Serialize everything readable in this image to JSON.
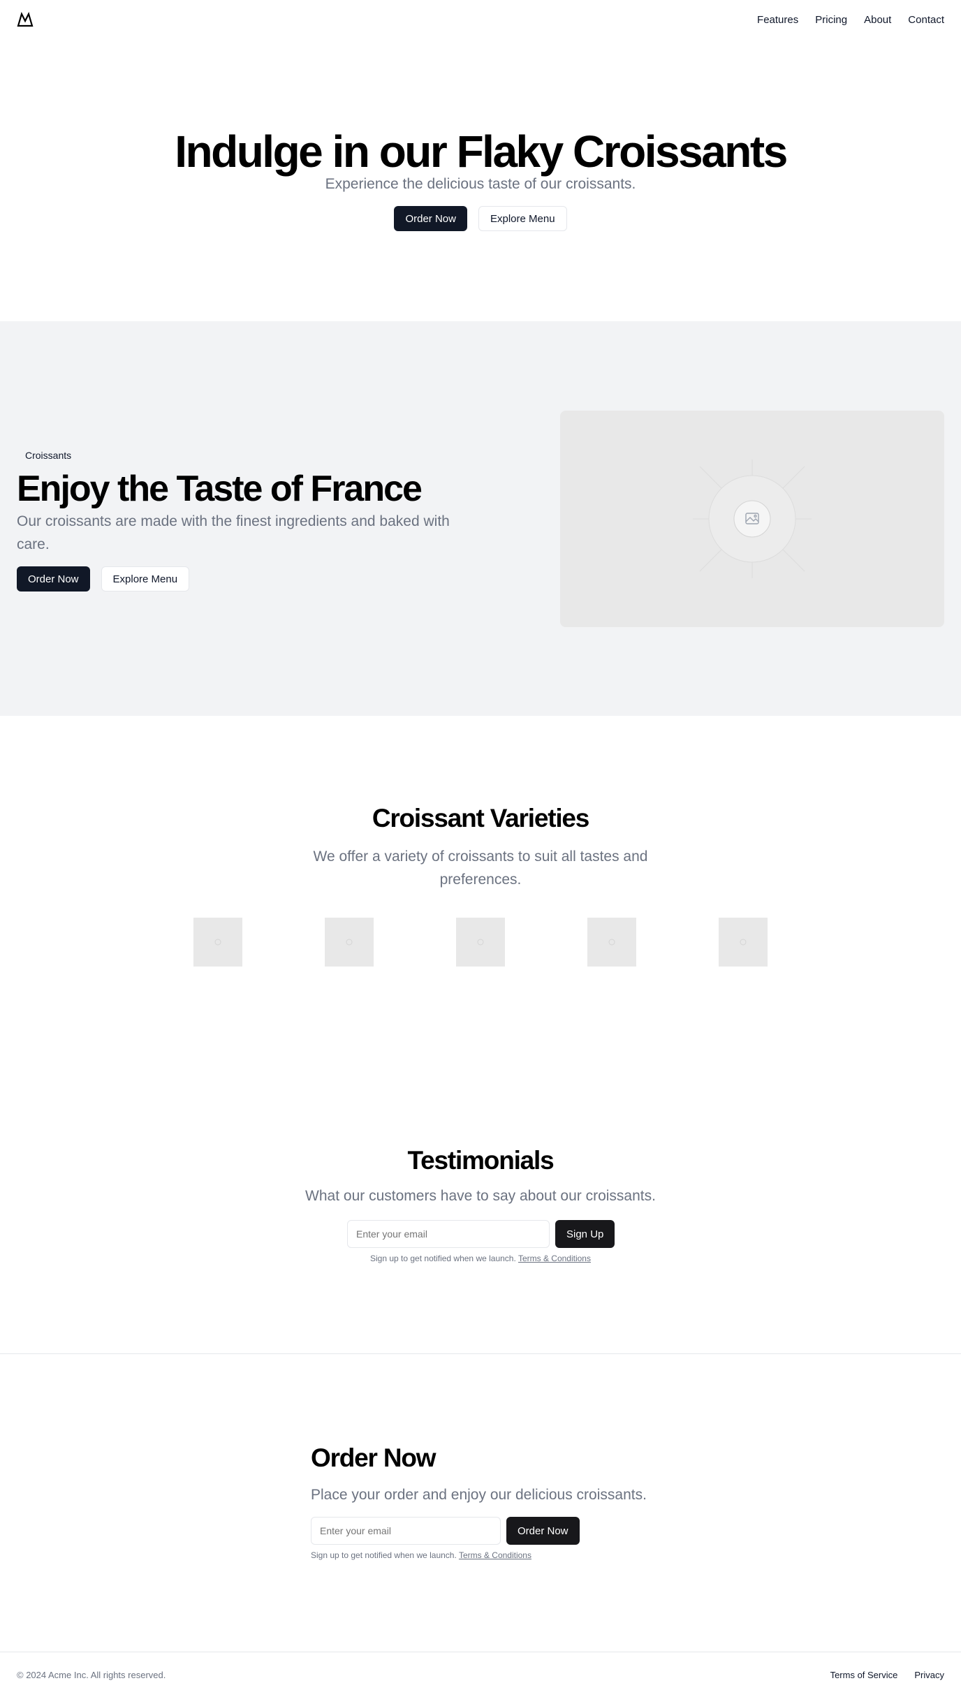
{
  "header": {
    "logo_icon": "mountain-icon",
    "nav": [
      "Features",
      "Pricing",
      "About",
      "Contact"
    ]
  },
  "hero": {
    "title": "Indulge in our Flaky Croissants",
    "subtitle": "Experience the delicious taste of our croissants.",
    "primary_btn": "Order Now",
    "secondary_btn": "Explore Menu"
  },
  "feature": {
    "badge": "Croissants",
    "title": "Enjoy the Taste of France",
    "description": "Our croissants are made with the finest ingredients and baked with care.",
    "primary_btn": "Order Now",
    "secondary_btn": "Explore Menu",
    "image_icon": "image-placeholder-icon"
  },
  "varieties": {
    "title": "Croissant Varieties",
    "description": "We offer a variety of croissants to suit all tastes and preferences.",
    "thumbnail_count": 5
  },
  "testimonials": {
    "title": "Testimonials",
    "description": "What our customers have to say about our croissants.",
    "email_placeholder": "Enter your email",
    "submit_btn": "Sign Up",
    "fine_print": "Sign up to get notified when we launch.",
    "terms_link": "Terms & Conditions"
  },
  "order": {
    "title": "Order Now",
    "description": "Place your order and enjoy our delicious croissants.",
    "email_placeholder": "Enter your email",
    "submit_btn": "Order Now",
    "fine_print": "Sign up to get notified when we launch.",
    "terms_link": "Terms & Conditions"
  },
  "footer": {
    "copyright": "© 2024 Acme Inc. All rights reserved.",
    "links": [
      "Terms of Service",
      "Privacy"
    ]
  },
  "colors": {
    "primary_button": "#111827",
    "section_bg": "#f2f3f5",
    "muted_text": "#6b7280",
    "placeholder_bg": "#e8e8e8"
  }
}
